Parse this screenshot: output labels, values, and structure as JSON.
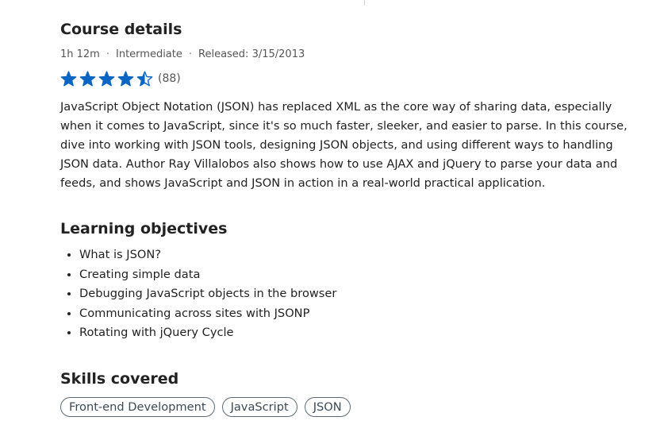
{
  "course": {
    "title": "Course details",
    "duration": "1h 12m",
    "level": "Intermediate",
    "released": "Released: 3/15/2013",
    "separator": "·",
    "rating": {
      "stars": 4.5,
      "max": 5,
      "count": "(88)",
      "star_color": "#0a66c2"
    },
    "description": "JavaScript Object Notation (JSON) has replaced XML as the core way of sharing data, especially when it comes to JavaScript, since it's so much faster, sleeker, and easier to parse. In this course, dive into working with JSON tools, designing JSON objects, and using different ways to handling JSON data. Author Ray Villalobos also shows how to use AJAX and jQuery to parse your data and feeds, and shows JavaScript and JSON in action in a real-world practical application."
  },
  "objectives": {
    "title": "Learning objectives",
    "items": [
      "What is JSON?",
      "Creating simple data",
      "Debugging JavaScript objects in the browser",
      "Communicating across sites with JSONP",
      "Rotating with jQuery Cycle"
    ]
  },
  "skills": {
    "title": "Skills covered",
    "items": [
      "Front-end Development",
      "JavaScript",
      "JSON"
    ]
  }
}
